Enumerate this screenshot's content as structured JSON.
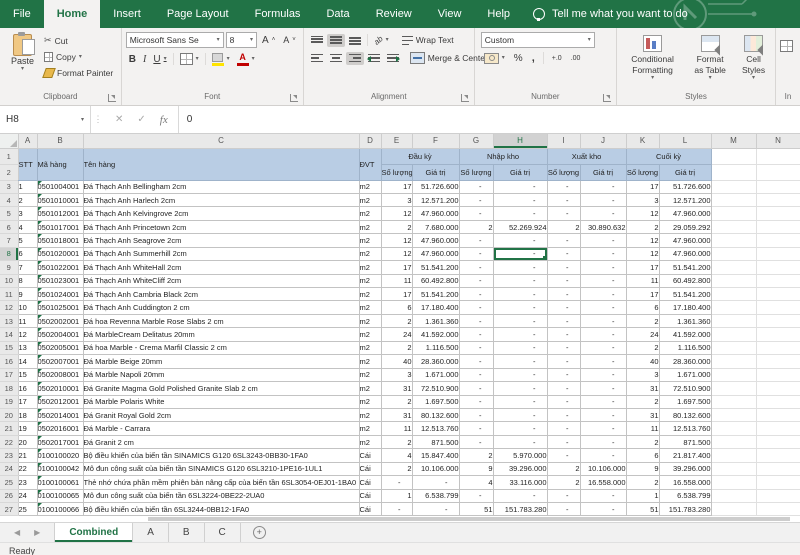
{
  "ribbon": {
    "tabs": [
      "File",
      "Home",
      "Insert",
      "Page Layout",
      "Formulas",
      "Data",
      "Review",
      "View",
      "Help"
    ],
    "active_tab": "Home",
    "tell_me": "Tell me what you want to do",
    "clipboard": {
      "label": "Clipboard",
      "paste": "Paste",
      "cut": "Cut",
      "copy": "Copy",
      "format_painter": "Format Painter"
    },
    "font": {
      "label": "Font",
      "font_name": "Microsoft Sans Se",
      "font_size": "8",
      "bold": "B",
      "italic": "I",
      "underline": "U"
    },
    "alignment": {
      "label": "Alignment",
      "wrap_text": "Wrap Text",
      "merge_center": "Merge & Center",
      "orientation": "ab"
    },
    "number": {
      "label": "Number",
      "format": "Custom",
      "percent": "%",
      "comma": ",",
      "inc_decimal": "+.0",
      "dec_decimal": ".00"
    },
    "styles": {
      "label": "Styles",
      "conditional": "Conditional Formatting",
      "format_table": "Format as Table",
      "cell_styles": "Cell Styles"
    },
    "cells_partial": "In"
  },
  "formula_bar": {
    "name_box": "H8",
    "cancel": "✕",
    "enter": "✓",
    "fx": "fx",
    "value": "0"
  },
  "grid": {
    "col_letters": [
      "A",
      "B",
      "C",
      "D",
      "E",
      "F",
      "G",
      "H",
      "I",
      "J",
      "K",
      "L",
      "M",
      "N"
    ],
    "selected_col": "H",
    "selected_row": 8,
    "selected_cell": "H8",
    "header": {
      "stt": "STT",
      "ma_hang": "Mã hàng",
      "ten_hang": "Tên hàng",
      "dvt": "ĐVT",
      "groups": [
        "Đầu kỳ",
        "Nhập kho",
        "Xuất kho",
        "Cuối kỳ"
      ],
      "qty": "Số lượng",
      "value": "Giá trị"
    },
    "rows": [
      [
        "1",
        "0501004001",
        "Đá Thạch Anh Bellingham 2cm",
        "m2",
        "17",
        "51.726.600",
        "-",
        "-",
        "-",
        "-",
        "17",
        "51.726.600"
      ],
      [
        "2",
        "0501010001",
        "Đá Thạch Anh Harlech 2cm",
        "m2",
        "3",
        "12.571.200",
        "-",
        "-",
        "-",
        "-",
        "3",
        "12.571.200"
      ],
      [
        "3",
        "0501012001",
        "Đá Thạch Anh Kelvingrove 2cm",
        "m2",
        "12",
        "47.960.000",
        "-",
        "-",
        "-",
        "-",
        "12",
        "47.960.000"
      ],
      [
        "4",
        "0501017001",
        "Đá Thạch Anh Princetown 2cm",
        "m2",
        "2",
        "7.680.000",
        "2",
        "52.269.924",
        "2",
        "30.890.632",
        "2",
        "29.059.292"
      ],
      [
        "5",
        "0501018001",
        "Đá Thạch Anh Seagrove 2cm",
        "m2",
        "12",
        "47.960.000",
        "-",
        "-",
        "-",
        "-",
        "12",
        "47.960.000"
      ],
      [
        "6",
        "0501020001",
        "Đá Thạch Anh Summerhill 2cm",
        "m2",
        "12",
        "47.960.000",
        "-",
        "-",
        "-",
        "-",
        "12",
        "47.960.000"
      ],
      [
        "7",
        "0501022001",
        "Đá Thạch Anh WhiteHall 2cm",
        "m2",
        "17",
        "51.541.200",
        "-",
        "-",
        "-",
        "-",
        "17",
        "51.541.200"
      ],
      [
        "8",
        "0501023001",
        "Đá Thạch Anh WhiteCliff 2cm",
        "m2",
        "11",
        "60.492.800",
        "-",
        "-",
        "-",
        "-",
        "11",
        "60.492.800"
      ],
      [
        "9",
        "0501024001",
        "Đá Thạch Anh Cambria Black 2cm",
        "m2",
        "17",
        "51.541.200",
        "-",
        "-",
        "-",
        "-",
        "17",
        "51.541.200"
      ],
      [
        "10",
        "0501025001",
        "Đá Thạch Anh Cuddington 2 cm",
        "m2",
        "6",
        "17.180.400",
        "-",
        "-",
        "-",
        "-",
        "6",
        "17.180.400"
      ],
      [
        "11",
        "0502002001",
        "Đá hoa Revenna Marble Rose Slabs 2 cm",
        "m2",
        "2",
        "1.361.360",
        "-",
        "-",
        "-",
        "-",
        "2",
        "1.361.360"
      ],
      [
        "12",
        "0502004001",
        "Đá MarbleCream Delitatus 20mm",
        "m2",
        "24",
        "41.592.000",
        "-",
        "-",
        "-",
        "-",
        "24",
        "41.592.000"
      ],
      [
        "13",
        "0502005001",
        "Đá hoa Marble - Crema Marfil Classic 2 cm",
        "m2",
        "2",
        "1.116.500",
        "-",
        "-",
        "-",
        "-",
        "2",
        "1.116.500"
      ],
      [
        "14",
        "0502007001",
        "Đá Marble Beige 20mm",
        "m2",
        "40",
        "28.360.000",
        "-",
        "-",
        "-",
        "-",
        "40",
        "28.360.000"
      ],
      [
        "15",
        "0502008001",
        "Đá Marble Napoli 20mm",
        "m2",
        "3",
        "1.671.000",
        "-",
        "-",
        "-",
        "-",
        "3",
        "1.671.000"
      ],
      [
        "16",
        "0502010001",
        "Đá Granite Magma Gold Polished Granite Slab 2 cm",
        "m2",
        "31",
        "72.510.900",
        "-",
        "-",
        "-",
        "-",
        "31",
        "72.510.900"
      ],
      [
        "17",
        "0502012001",
        "Đá Marble Polaris White",
        "m2",
        "2",
        "1.697.500",
        "-",
        "-",
        "-",
        "-",
        "2",
        "1.697.500"
      ],
      [
        "18",
        "0502014001",
        "Đá Granit Royal Gold 2cm",
        "m2",
        "31",
        "80.132.600",
        "-",
        "-",
        "-",
        "-",
        "31",
        "80.132.600"
      ],
      [
        "19",
        "0502016001",
        "Đá Marble - Carrara",
        "m2",
        "11",
        "12.513.760",
        "-",
        "-",
        "-",
        "-",
        "11",
        "12.513.760"
      ],
      [
        "20",
        "0502017001",
        "Đá Granit 2 cm",
        "m2",
        "2",
        "871.500",
        "-",
        "-",
        "-",
        "-",
        "2",
        "871.500"
      ],
      [
        "21",
        "0100100020",
        "Bộ điều khiển của biến tần SINAMICS G120 6SL3243-0BB30-1FA0",
        "Cái",
        "4",
        "15.847.400",
        "2",
        "5.970.000",
        "-",
        "-",
        "6",
        "21.817.400"
      ],
      [
        "22",
        "0100100042",
        "Mô đun công suất của biến tần SINAMICS G120 6SL3210-1PE16-1UL1",
        "Cái",
        "2",
        "10.106.000",
        "9",
        "39.296.000",
        "2",
        "10.106.000",
        "9",
        "39.296.000"
      ],
      [
        "23",
        "0100100061",
        "Thẻ nhớ chứa phần mềm phiên bản nâng cấp của biến tần 6SL3054-0EJ01-1BA0",
        "Cái",
        "-",
        "-",
        "4",
        "33.116.000",
        "2",
        "16.558.000",
        "2",
        "16.558.000"
      ],
      [
        "24",
        "0100100065",
        "Mô đun công suất của biến tần 6SL3224-0BE22-2UA0",
        "Cái",
        "1",
        "6.538.799",
        "-",
        "-",
        "-",
        "-",
        "1",
        "6.538.799"
      ],
      [
        "25",
        "0100100066",
        "Bộ điều khiển của biến tần 6SL3244-0BB12-1FA0",
        "Cái",
        "-",
        "-",
        "51",
        "151.783.280",
        "-",
        "-",
        "51",
        "151.783.280"
      ]
    ]
  },
  "sheet_tabs": {
    "active": "Combined",
    "others": [
      "A",
      "B",
      "C"
    ]
  },
  "status_bar": {
    "text": "Ready"
  },
  "colors": {
    "accent_green": "#217346",
    "header_fill": "#b9cde4",
    "fill_color_swatch": "#ffe400",
    "font_color_swatch": "#c00000"
  }
}
